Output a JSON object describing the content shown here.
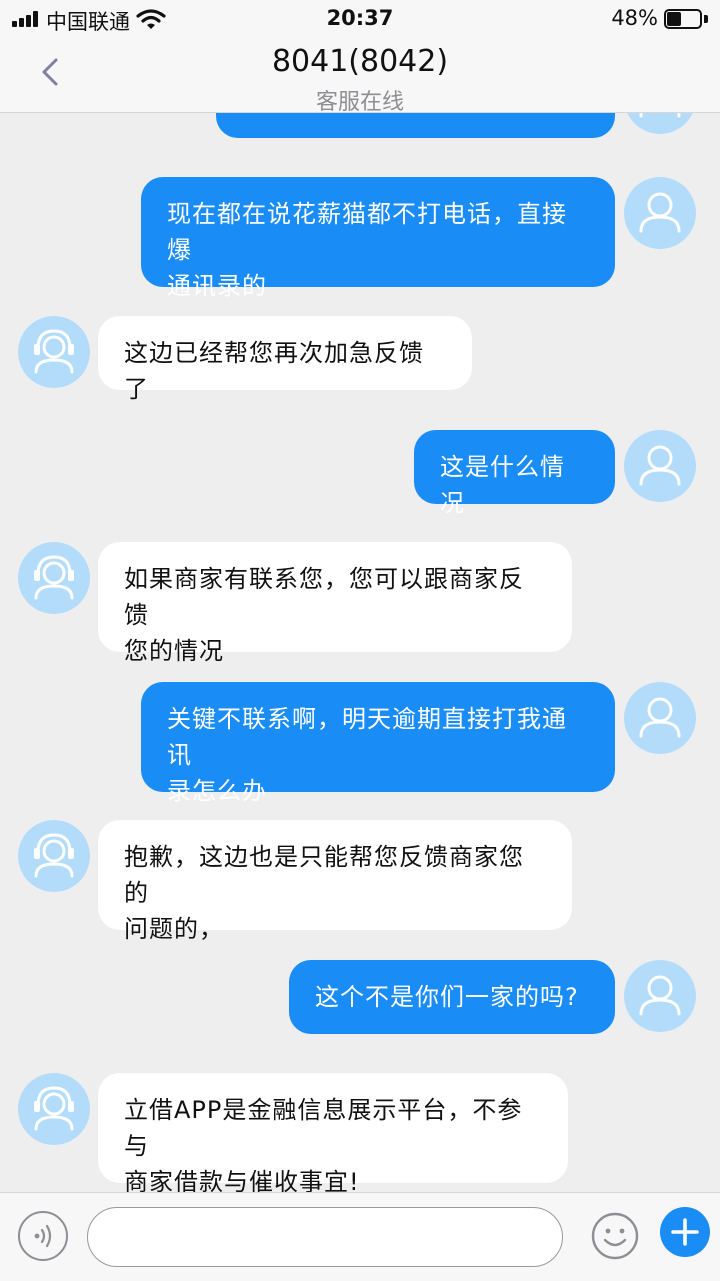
{
  "status_bar": {
    "carrier": "中国联通",
    "time": "20:37",
    "battery_percent": "48%",
    "battery_level": 0.48
  },
  "header": {
    "title": "8041(8042)",
    "subtitle": "客服在线"
  },
  "messages": [
    {
      "from": "me",
      "text": "现在都在说花薪猫都不打电话，直接爆\n通讯录的"
    },
    {
      "from": "agent",
      "text": "这边已经帮您再次加急反馈了"
    },
    {
      "from": "me",
      "text": "这是什么情况"
    },
    {
      "from": "agent",
      "text": "如果商家有联系您，您可以跟商家反馈\n您的情况"
    },
    {
      "from": "me",
      "text": "关键不联系啊，明天逾期直接打我通讯\n录怎么办"
    },
    {
      "from": "agent",
      "text": "抱歉，这边也是只能帮您反馈商家您的\n问题的，"
    },
    {
      "from": "me",
      "text": "这个不是你们一家的吗?"
    },
    {
      "from": "agent",
      "text": "立借APP是金融信息展示平台，不参与\n商家借款与催收事宜!"
    }
  ],
  "input": {
    "value": "",
    "placeholder": ""
  },
  "colors": {
    "accent": "#1a8cf5",
    "avatar_bg": "#b3dcfb",
    "background": "#eeeeef"
  },
  "icons": {
    "back": "chevron-left-icon",
    "user_avatar": "user-avatar-icon",
    "agent_avatar": "headset-agent-icon",
    "voice": "voice-icon",
    "emoji": "smiley-icon",
    "more": "plus-icon"
  }
}
